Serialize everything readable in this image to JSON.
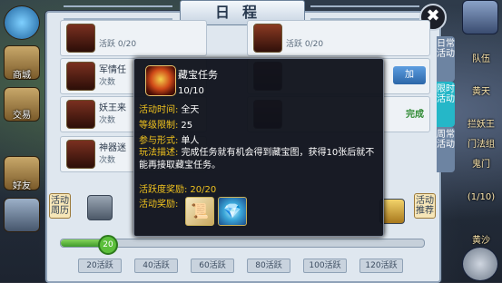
{
  "window": {
    "title": "日程",
    "close_icon": "✖"
  },
  "left_sidebar": {
    "items": [
      {
        "label": "商城",
        "icon": "shop-icon"
      },
      {
        "label": "交易",
        "icon": "trade-icon"
      },
      {
        "label": "好友",
        "icon": "friend-icon"
      }
    ]
  },
  "right_sidebar": {
    "items": [
      {
        "label": "队伍",
        "icon": "team-icon"
      },
      {
        "label": "黄天",
        "icon": "quest-icon"
      },
      {
        "label": "拦妖王",
        "icon": "boss-icon"
      },
      {
        "label": "门法组",
        "icon": "sect-icon"
      },
      {
        "label": "鬼门",
        "icon": "ghost-icon"
      },
      {
        "label": "(1/10)",
        "icon": "progress-icon"
      },
      {
        "label": "黄沙",
        "icon": "sand-icon"
      }
    ]
  },
  "tabs": [
    {
      "label": "日常活动"
    },
    {
      "label": "限时活动"
    },
    {
      "label": "周常活动"
    }
  ],
  "activities": [
    {
      "name": "",
      "info": "活跃 0/20"
    },
    {
      "name": "军情任",
      "info": "次数"
    },
    {
      "name": "妖王来",
      "info": "次数"
    },
    {
      "name": "神器迷",
      "info": "次数"
    }
  ],
  "right_activities": [
    {
      "info": "活跃 0/20",
      "action": ""
    },
    {
      "info": "",
      "action": "加"
    },
    {
      "info": "",
      "action": "完成"
    }
  ],
  "activity_progress": {
    "left_tab": "活动周历",
    "right_tab": "活动推荐",
    "current": "20",
    "fill_fraction": 0.13,
    "milestones": [
      "20活跃",
      "40活跃",
      "60活跃",
      "80活跃",
      "100活跃",
      "120活跃"
    ]
  },
  "popup": {
    "name": "藏宝任务",
    "count": "10/10",
    "time_label": "活动时间:",
    "time_value": "全天",
    "level_label": "等级限制:",
    "level_value": "25",
    "form_label": "参与形式:",
    "form_value": "单人",
    "desc_label": "玩法描述:",
    "desc_value": "完成任务就有机会得到藏宝图，获得10张后就不能再接取藏宝任务。",
    "activity_label": "活跃度奖励:",
    "activity_value": "20/20",
    "reward_label": "活动奖励:",
    "rewards": [
      {
        "icon": "treasure-map-icon"
      },
      {
        "icon": "crystal-icon"
      }
    ]
  }
}
